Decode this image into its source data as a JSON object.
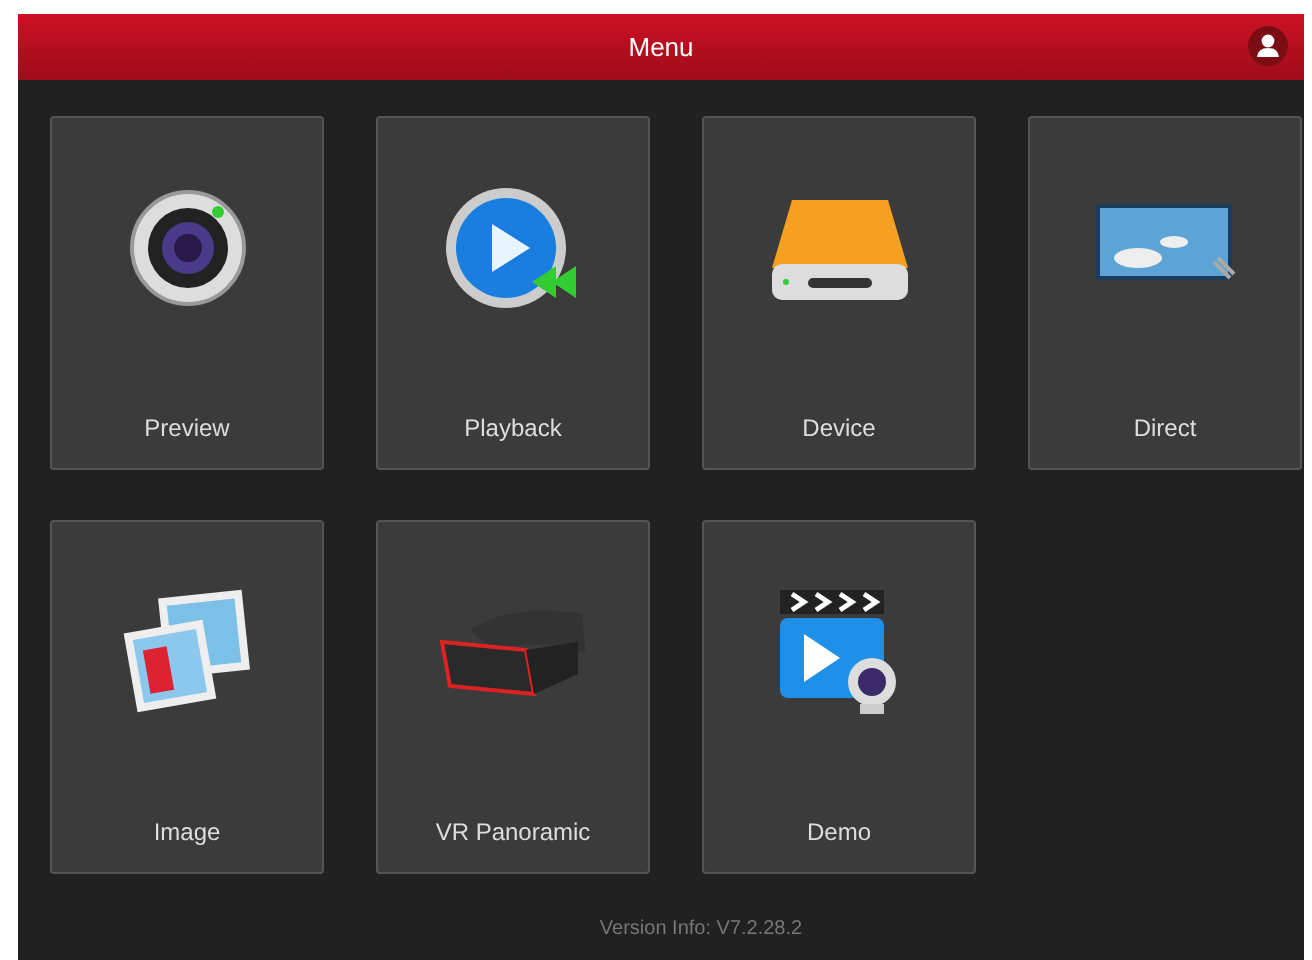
{
  "header": {
    "title": "Menu"
  },
  "tiles": [
    {
      "label": "Preview",
      "kind": "camera"
    },
    {
      "label": "Playback",
      "kind": "playback"
    },
    {
      "label": "Device",
      "kind": "drive"
    },
    {
      "label": "Direct",
      "kind": "picture"
    },
    {
      "label": "Image",
      "kind": "photos"
    },
    {
      "label": "VR Panoramic",
      "kind": "headset"
    },
    {
      "label": "Demo",
      "kind": "video"
    }
  ],
  "footer": {
    "version": "Version Info: V7.2.28.2"
  }
}
